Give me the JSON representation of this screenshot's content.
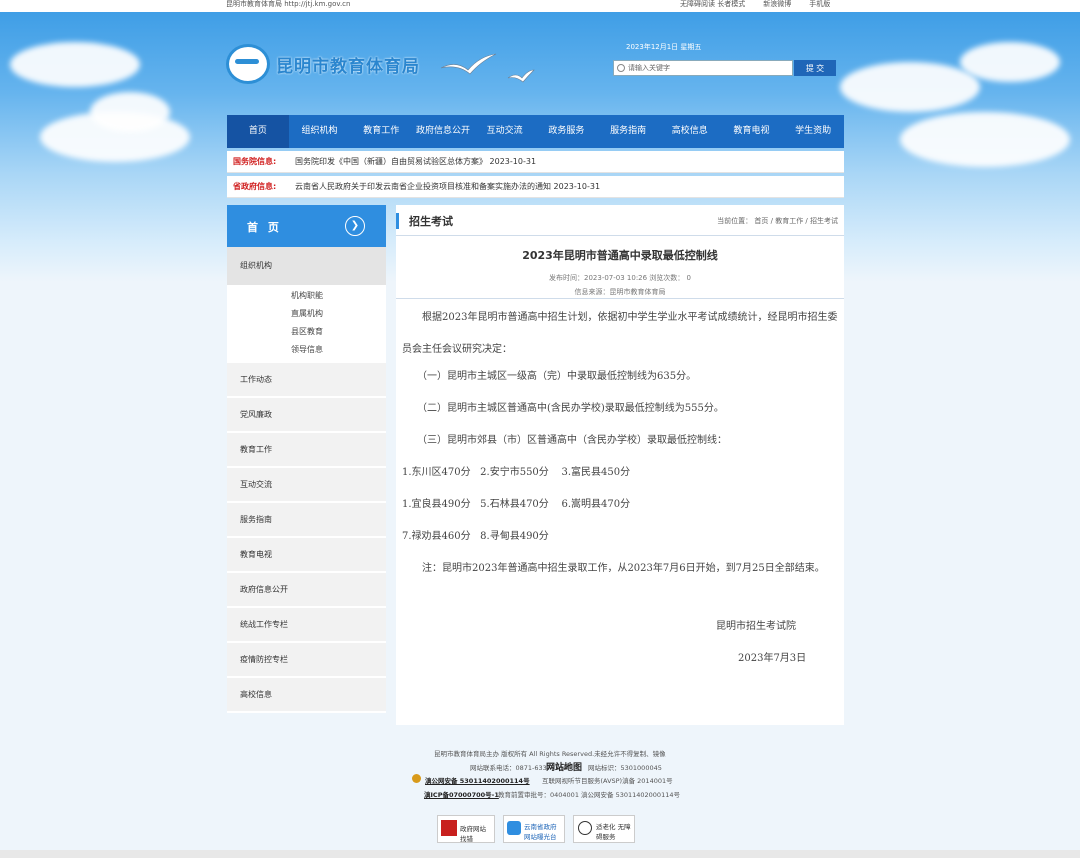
{
  "topbar": {
    "site": "昆明市教育体育局 http://jtj.km.gov.cn",
    "links": [
      "无障碍阅读 长者模式",
      "新浪微博",
      "手机版"
    ]
  },
  "header": {
    "logo_text": "昆明市教育体育局",
    "date": "2023年12月1日 星期五",
    "search_placeholder": "请输入关键字",
    "search_button": "提 交"
  },
  "nav": [
    "首页",
    "组织机构",
    "教育工作",
    "政府信息公开",
    "互动交流",
    "政务服务",
    "服务指南",
    "高校信息",
    "教育电视",
    "学生资助"
  ],
  "notices": [
    {
      "tag": "国务院信息:",
      "text": "国务院印发《中国（新疆）自由贸易试验区总体方案》 2023-10-31"
    },
    {
      "tag": "省政府信息:",
      "text": "云南省人民政府关于印发云南省企业投资项目核准和备案实施办法的通知 2023-10-31"
    }
  ],
  "sidebar": {
    "home": "首 页",
    "open_item": "组织机构",
    "sub_items": [
      "机构职能",
      "直属机构",
      "县区教育",
      "领导信息"
    ],
    "items": [
      "工作动态",
      "党风廉政",
      "教育工作",
      "互动交流",
      "服务指南",
      "教育电视",
      "政府信息公开",
      "统战工作专栏",
      "疫情防控专栏",
      "高校信息"
    ]
  },
  "article": {
    "section": "招生考试",
    "breadcrumb": "当前位置： 首页 / 教育工作 / 招生考试",
    "title": "2023年昆明市普通高中录取最低控制线",
    "publish": "发布时间：2023-07-03 10:26      浏览次数： 0",
    "source": "信息来源：昆明市教育体育局",
    "paragraphs": [
      "　　根据2023年昆明市普通高中招生计划，依据初中学生学业水平考试成绩统计，经昆明市招生委员会主任会议研究决定：",
      "　　（一）昆明市主城区一级高（完）中录取最低控制线为635分。",
      "　　（二）昆明市主城区普通高中(含民办学校)录取最低控制线为555分。",
      "　　（三）昆明市郊县（市）区普通高中（含民办学校）录取最低控制线：",
      "1.东川区470分   2.安宁市550分    3.富民县450分",
      "1.宜良县490分   5.石林县470分    6.嵩明县470分",
      "7.禄劝县460分   8.寻甸县490分",
      "　　注：昆明市2023年普通高中招生录取工作，从2023年7月6日开始，到7月25日全部结束。"
    ],
    "signature": "昆明市招生考试院",
    "sign_date": "2023年7月3日"
  },
  "footer": {
    "line1": "昆明市教育体育局主办 版权所有 All Rights Reserved.未经允许不得复制、镜像",
    "line2_a": "网站联系电话：0871-63377718",
    "line2_b": "网站地图",
    "line2_c": "网站标识：5301000045",
    "line3_a": "滇公网安备 53011402000114号",
    "line3_b": "互联网视听节目服务(AVSP)滇备 2014001号",
    "line4_a": "滇ICP备07000700号-1",
    "line4_b": "教育前置审批号：0404001 滇公网安备 53011402000114号",
    "badges": [
      "政府网站 找错",
      "云南省政府 网站曝光台",
      "适老化 无障碍服务"
    ]
  }
}
